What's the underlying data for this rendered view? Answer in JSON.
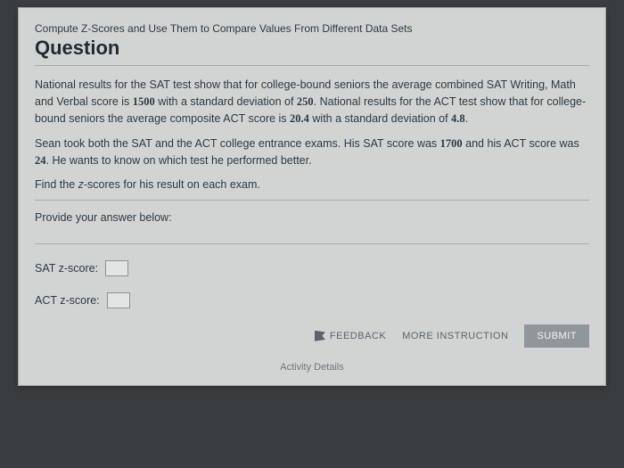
{
  "topic": "Compute Z-Scores and Use Them to Compare Values From Different Data Sets",
  "heading": "Question",
  "p1_a": "National results for the SAT test show that for college-bound seniors the average combined SAT Writing, Math and Verbal score is ",
  "n_1500": "1500",
  "p1_b": " with a standard deviation of ",
  "n_250": "250",
  "p1_c": ". National results for the ACT test show that for college-bound seniors the average composite ACT score is ",
  "n_204": "20.4",
  "p1_d": " with a standard deviation of ",
  "n_48": "4.8",
  "p1_e": ".",
  "p2_a": "Sean took both the SAT and the ACT college entrance exams.  His SAT score was ",
  "n_1700": "1700",
  "p2_b": " and his ACT score was ",
  "n_24": "24",
  "p2_c": ".  He wants to know on which test he performed better.",
  "find_a": "Find the ",
  "find_z": "z",
  "find_b": "-scores for his result on each exam.",
  "provide": "Provide your answer below:",
  "sat_label": "SAT z-score:",
  "act_label": "ACT z-score:",
  "feedback": "FEEDBACK",
  "more": "MORE INSTRUCTION",
  "submit": "SUBMIT",
  "footer": "Activity Details"
}
